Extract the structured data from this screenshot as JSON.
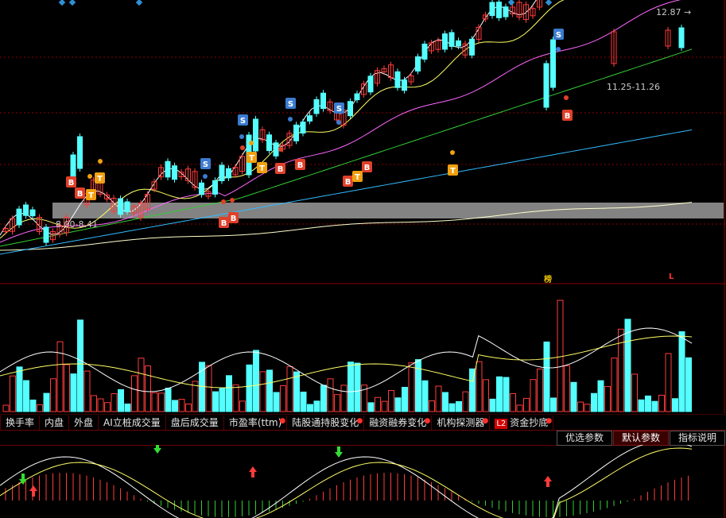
{
  "price_chart": {
    "last_price": "12.87",
    "range_high_label": "11.25-11.26",
    "range_low_label": "8.00-8.41",
    "top_marker_bang": "榜",
    "top_marker_l": "L",
    "signal_labels": {
      "S": "S",
      "B": "B",
      "T": "T"
    }
  },
  "tabs": [
    {
      "label": "换手率",
      "dot": false
    },
    {
      "label": "内盘",
      "dot": false
    },
    {
      "label": "外盘",
      "dot": false
    },
    {
      "label": "AI立桩成交量",
      "dot": false
    },
    {
      "label": "盘后成交量",
      "dot": false
    },
    {
      "label": "市盈率(ttm)",
      "dot": true
    },
    {
      "label": "陆股通持股变化",
      "dot": true
    },
    {
      "label": "融资融券变化",
      "dot": true
    },
    {
      "label": "机构探测器",
      "dot": true
    },
    {
      "label": "资金抄底",
      "dot": true,
      "badge": "L2"
    }
  ],
  "subbar": {
    "optimize_params": "优选参数",
    "default_params": "默认参数",
    "indicator_help": "指标说明"
  },
  "colors": {
    "up": "#ff3b3b",
    "down": "#54ffff",
    "ma5": "#ffffff",
    "ma10": "#ffff66",
    "ma20": "#ff66ff",
    "ma30": "#33cc33",
    "ma60": "#33bbff",
    "ma120": "#ffffcc",
    "band": "#9a9a9a"
  }
}
